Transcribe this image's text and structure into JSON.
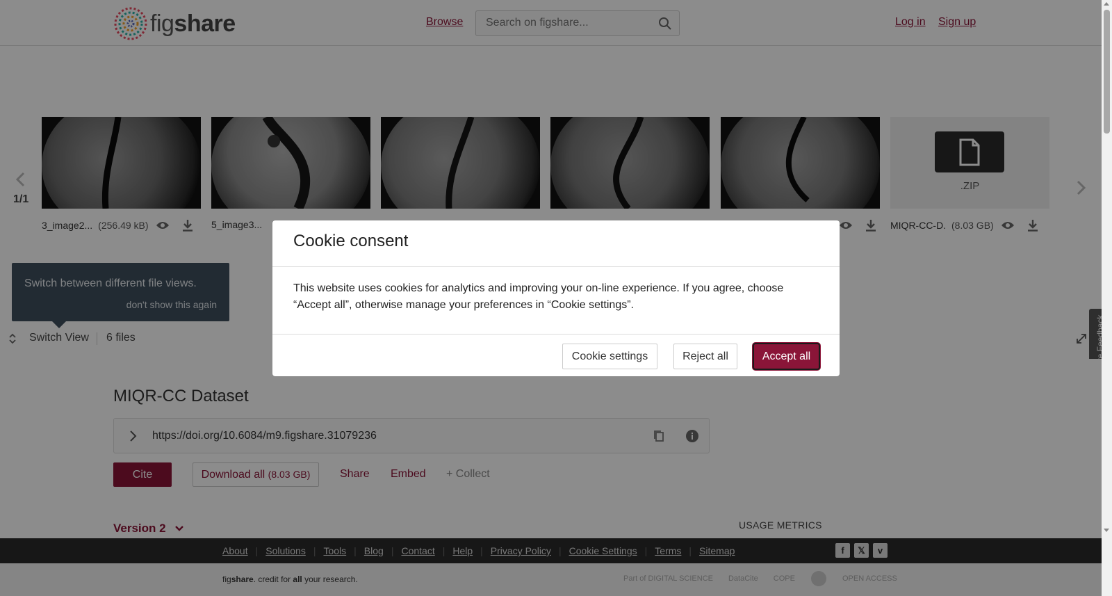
{
  "header": {
    "logo_text_light": "fig",
    "logo_text_bold": "share",
    "browse_label": "Browse",
    "search_placeholder": "Search on figshare...",
    "login_label": "Log in",
    "signup_label": "Sign up"
  },
  "carousel": {
    "pager": "1/1",
    "files": [
      {
        "name": "3_image2...",
        "size": "(256.49 kB)"
      },
      {
        "name": "5_image3...",
        "size": ""
      },
      {
        "name": "",
        "size": ""
      },
      {
        "name": "",
        "size": ""
      },
      {
        "name": "",
        "size": ""
      },
      {
        "name": "MIQR-CC-D...",
        "size": "(8.03 GB)",
        "type_label": ".ZIP"
      }
    ],
    "tip_text": "Switch between different file views.",
    "tip_dismiss": "don't show this again",
    "switch_view_label": "Switch View",
    "files_count": "6 files",
    "feedback_label": "Give Feedback"
  },
  "main": {
    "title": "MIQR-CC Dataset",
    "doi": "https://doi.org/10.6084/m9.figshare.31079236",
    "cite_label": "Cite",
    "download_label": "Download all",
    "download_size": "(8.03 GB)",
    "share_label": "Share",
    "embed_label": "Embed",
    "collect_label": "+ Collect",
    "version_label": "Version 2",
    "usage_label": "USAGE METRICS"
  },
  "footer": {
    "links": [
      "About",
      "Solutions",
      "Tools",
      "Blog",
      "Contact",
      "Help",
      "Privacy Policy",
      "Cookie Settings",
      "Terms",
      "Sitemap"
    ],
    "social": [
      "facebook-icon",
      "x-icon",
      "vimeo-icon"
    ],
    "tagline_pre": "fig",
    "tagline_bold": "share",
    "tagline_mid": ". credit for ",
    "tagline_all": "all",
    "tagline_post": " your research.",
    "partners": [
      "Part of DIGITAL SCIENCE",
      "DataCite",
      "COPE",
      "",
      "OPEN ACCESS"
    ]
  },
  "cookie_modal": {
    "title": "Cookie consent",
    "body": "This website uses cookies for analytics and improving your on-line experience. If you agree, choose “Accept all”, otherwise manage your preferences in “Cookie settings”.",
    "settings_label": "Cookie settings",
    "reject_label": "Reject all",
    "accept_label": "Accept all"
  },
  "colors": {
    "brand": "#8a1538",
    "tip_bg": "#3f4f5e",
    "footer_bg": "#2a2a2a"
  }
}
